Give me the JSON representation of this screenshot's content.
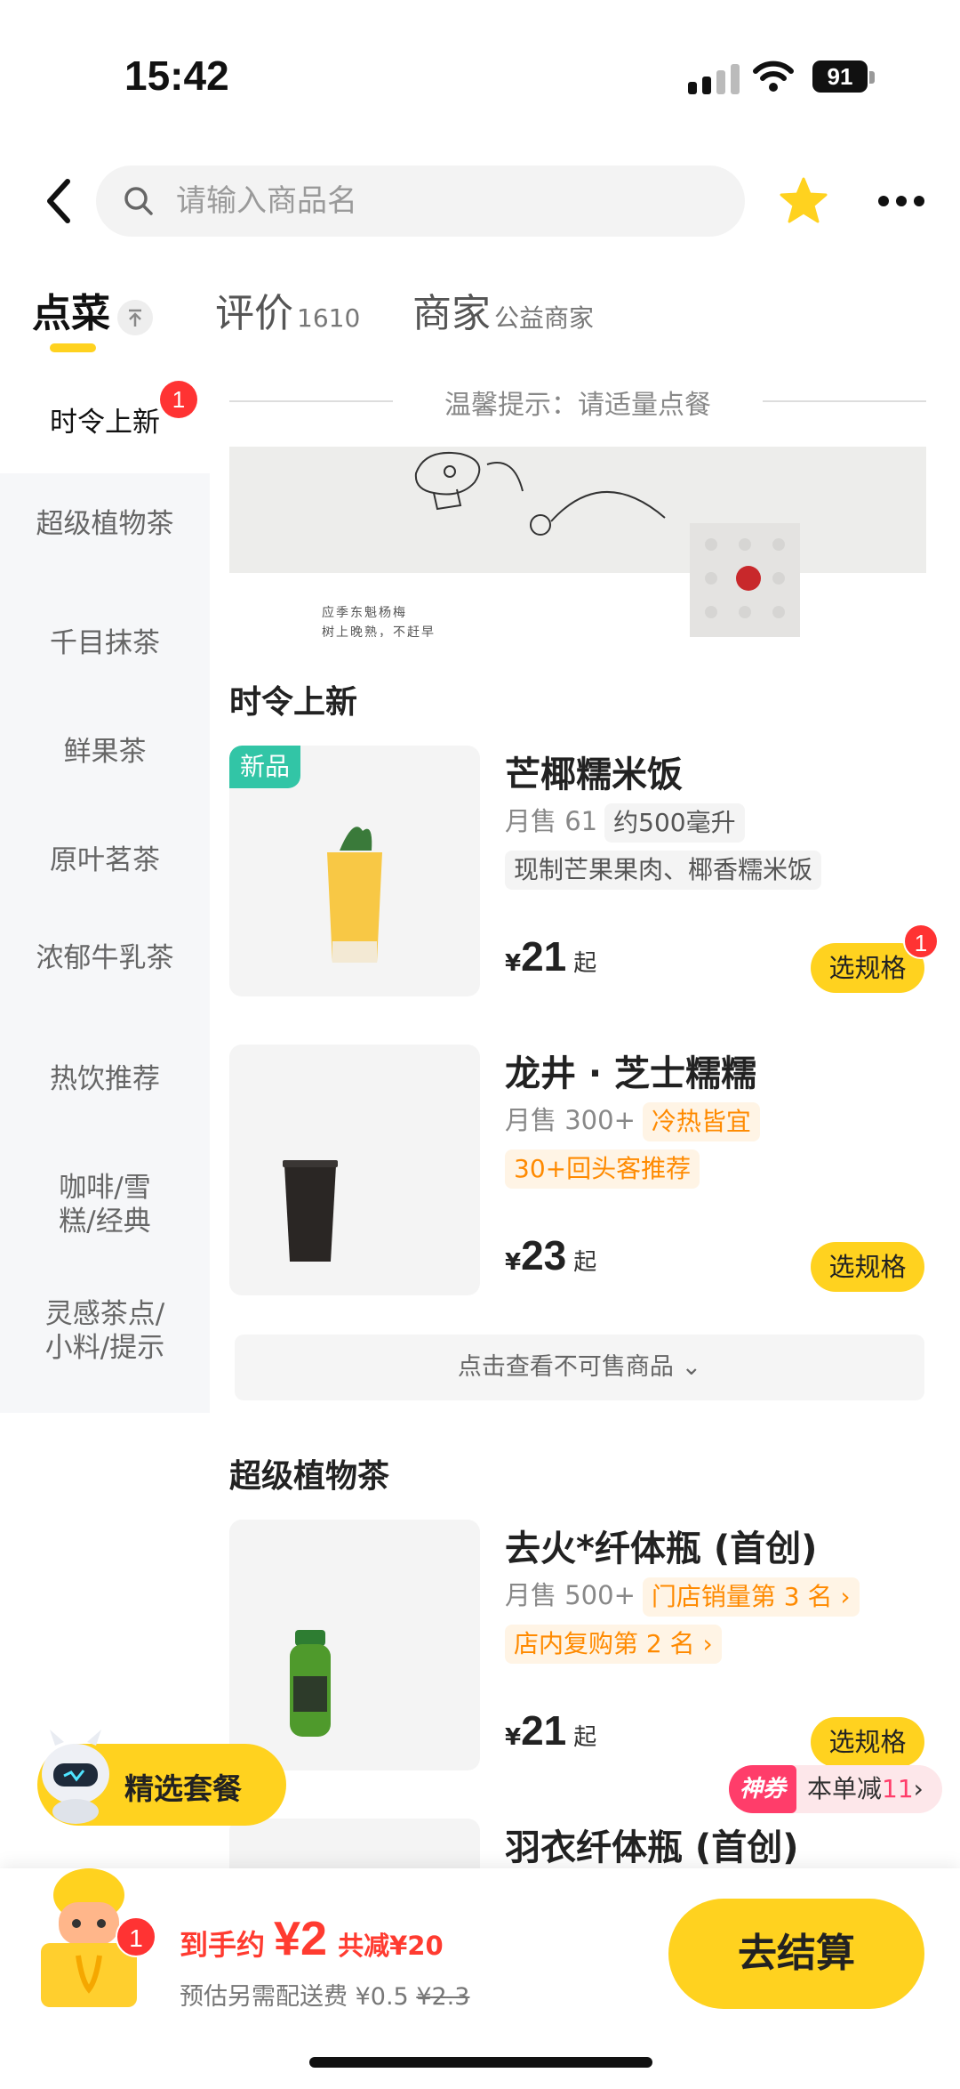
{
  "status_bar": {
    "time": "15:42",
    "battery": "91"
  },
  "header": {
    "search_placeholder": "请输入商品名"
  },
  "tabs": [
    {
      "label": "点菜",
      "sub": ""
    },
    {
      "label": "评价",
      "sub": "1610"
    },
    {
      "label": "商家",
      "sub": "公益商家"
    }
  ],
  "sidebar": {
    "items": [
      {
        "label": "时令上新",
        "badge": "1"
      },
      {
        "label": "超级植物茶"
      },
      {
        "label": "千目抹茶"
      },
      {
        "label": "鲜果茶"
      },
      {
        "label": "原叶茗茶"
      },
      {
        "label": "浓郁牛乳茶"
      },
      {
        "label": "热饮推荐"
      },
      {
        "label": "咖啡/雪糕/经典"
      },
      {
        "label": "灵感茶点/小料/提示"
      }
    ]
  },
  "content": {
    "tip": "温馨提示：请适量点餐",
    "banner_text": [
      "应季东魁杨梅",
      "树上晚熟，不赶早"
    ],
    "sections": [
      {
        "title": "时令上新"
      },
      {
        "title": "超级植物茶"
      }
    ],
    "products": [
      {
        "tag": "新品",
        "name": "芒椰糯米饭",
        "sales": "月售 61",
        "chip": "约500毫升",
        "desc": "现制芒果果肉、椰香糯米饭",
        "yen": "¥",
        "price": "21",
        "qi": "起",
        "button": "选规格",
        "badge": "1"
      },
      {
        "name": "龙井 · 芝士糯糯",
        "sales": "月售 300+",
        "chip": "冷热皆宜",
        "desc": "30+回头客推荐",
        "yen": "¥",
        "price": "23",
        "qi": "起",
        "button": "选规格"
      },
      {
        "name": "去火*纤体瓶 (首创)",
        "sales": "月售 500+",
        "chip": "门店销量第 3 名 ›",
        "desc": "店内复购第 2 名 ›",
        "yen": "¥",
        "price": "21",
        "qi": "起",
        "button": "选规格"
      },
      {
        "name": "羽衣纤体瓶 (首创)"
      }
    ],
    "unavailable": "点击查看不可售商品 ⌄"
  },
  "floating": {
    "combo": "精选套餐",
    "promo_god": "神券",
    "promo_text": "本单减",
    "promo_value": "11",
    "promo_arrow": "›"
  },
  "cart": {
    "badge": "1",
    "label": "到手约",
    "amount": "¥2",
    "save": "共减¥20",
    "delivery_label": "预估另需配送费",
    "delivery_fee": "¥0.5",
    "delivery_original": "¥2.3",
    "checkout": "去结算"
  },
  "colors": {
    "accent": "#ffd21f",
    "price_red": "#ff3b30",
    "new_tag": "#32c5a6",
    "chip_orange": "#ff8a00"
  }
}
